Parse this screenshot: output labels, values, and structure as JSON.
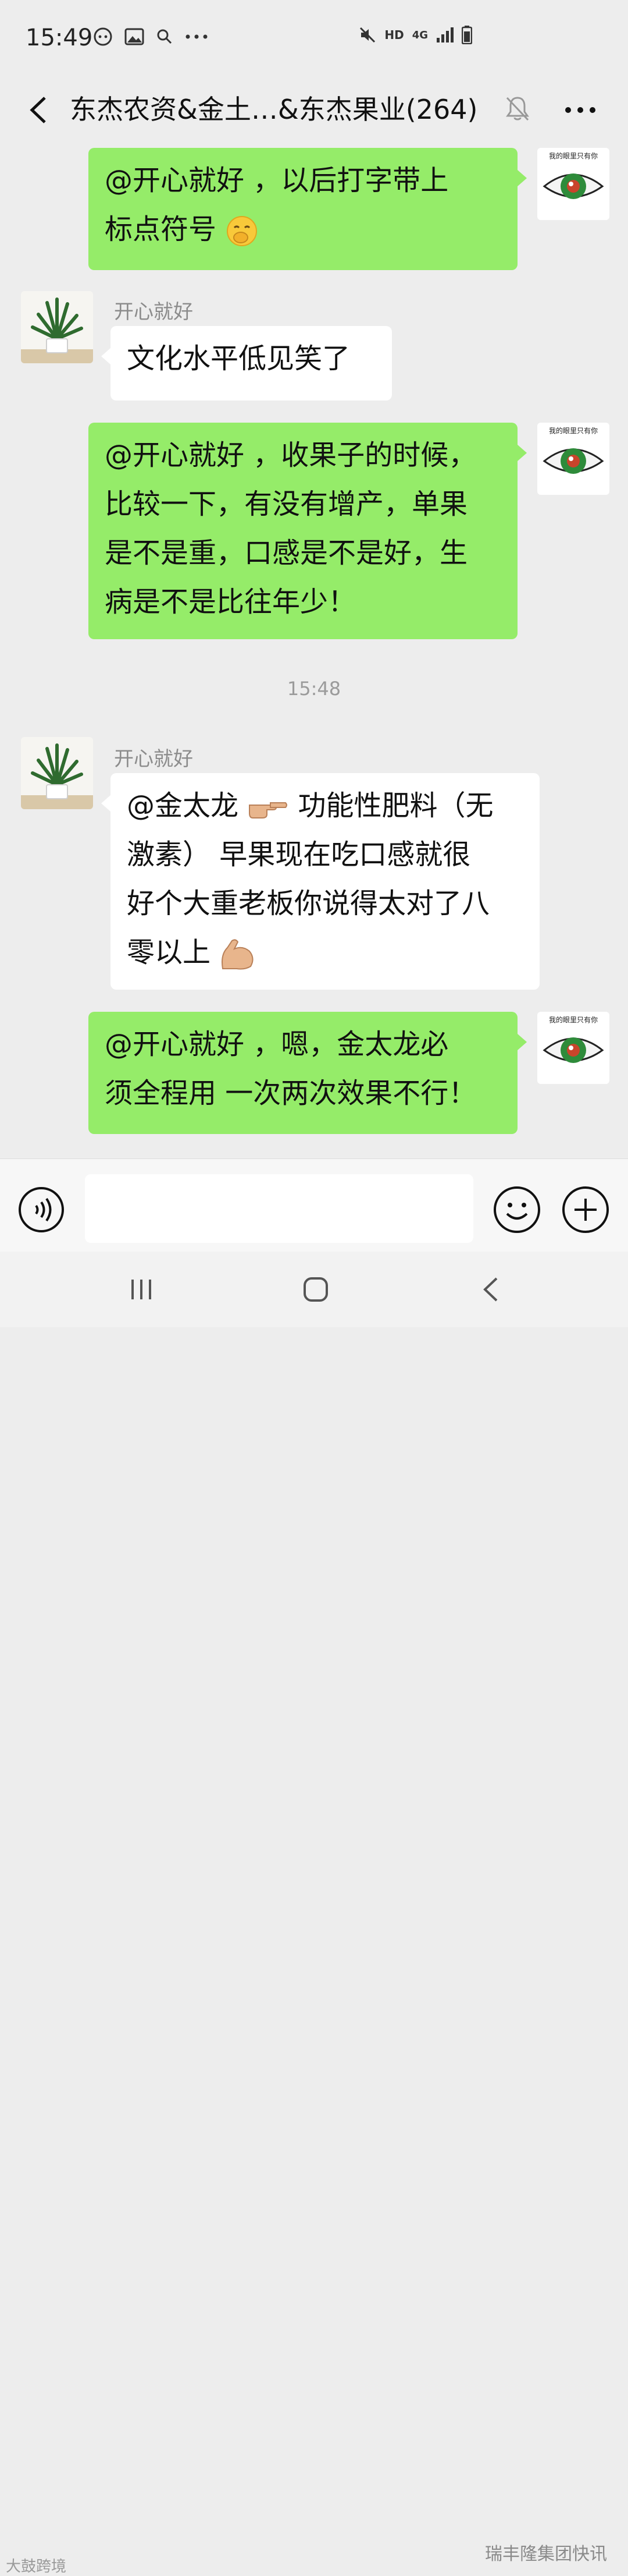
{
  "status_bar": {
    "time": "15:49",
    "icons_left": [
      "chat-bubble-icon",
      "image-icon",
      "search-icon",
      "more-dots-icon"
    ],
    "icons_right": [
      "mute-icon",
      "hd-label",
      "4g-signal-icon",
      "battery-icon"
    ],
    "hd_label": "HD",
    "network_label": "4G"
  },
  "header": {
    "title": "东杰农资&金土…&东杰果业(264)",
    "back_icon": "chevron-left-icon",
    "mute_icon": "bell-off-icon",
    "more_icon": "more-dots-icon"
  },
  "messages": [
    {
      "direction": "out",
      "avatar": "eye-avatar",
      "avatar_caption": "我的眼里只有你",
      "lines": [
        "@开心就好  ，以后打字带上",
        "标点符号"
      ],
      "emoji": "hand-over-mouth-emoji"
    },
    {
      "direction": "in",
      "sender": "开心就好",
      "avatar": "plant-avatar",
      "lines": [
        "文化水平低见笑了"
      ]
    },
    {
      "direction": "out",
      "avatar": "eye-avatar",
      "avatar_caption": "我的眼里只有你",
      "lines": [
        "@开心就好  ，收果子的时候，",
        "比较一下，有没有增产，单果",
        "是不是重，口感是不是好，生",
        "病是不是比往年少！"
      ]
    },
    {
      "type": "timestamp",
      "text": "15:48"
    },
    {
      "direction": "in",
      "sender": "开心就好",
      "avatar": "plant-avatar",
      "lines": [
        "@金太龙",
        "功能性肥料（无",
        "激素）  早果现在吃口感就很",
        "好个大重老板你说得太对了八",
        "零以上"
      ],
      "emojis": [
        "pointing-right-emoji",
        "flexed-biceps-emoji"
      ]
    },
    {
      "direction": "out",
      "avatar": "eye-avatar",
      "avatar_caption": "我的眼里只有你",
      "lines": [
        "@开心就好  ，嗯，金太龙必",
        "须全程用 一次两次效果不行！"
      ]
    }
  ],
  "input_bar": {
    "voice_icon": "voice-icon",
    "placeholder": "",
    "emoji_icon": "smile-icon",
    "plus_icon": "plus-circle-icon"
  },
  "system_nav": {
    "recent_icon": "recent-apps-icon",
    "home_icon": "home-icon",
    "back_icon": "back-icon"
  },
  "watermarks": {
    "left": "大鼓跨境",
    "right": "瑞丰隆集团快讯"
  },
  "colors": {
    "background": "#ededed",
    "outgoing_bubble": "#95ec69",
    "incoming_bubble": "#ffffff",
    "sender_text": "#8c8c8c"
  }
}
